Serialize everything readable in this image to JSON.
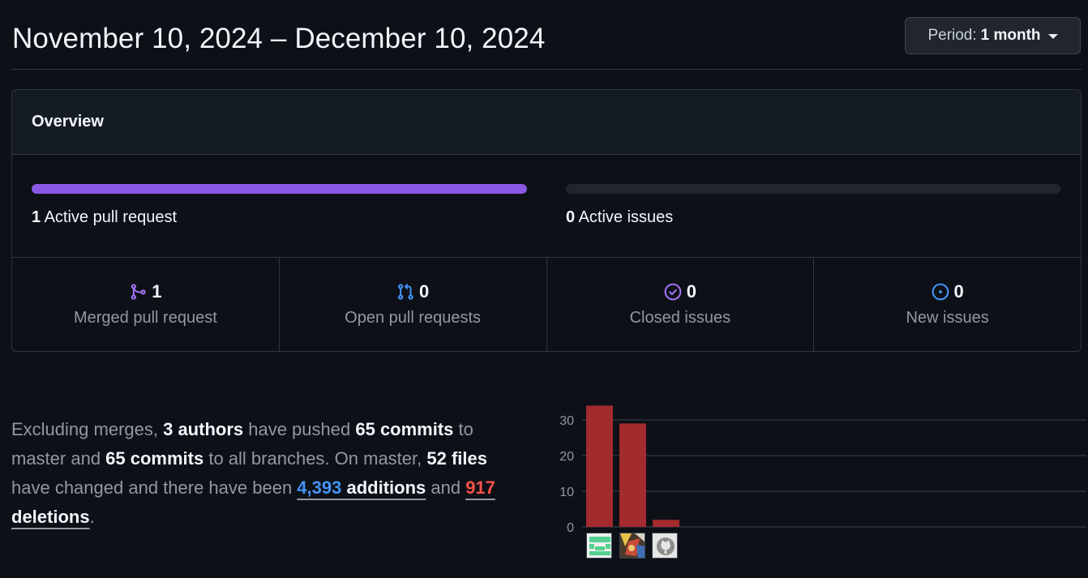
{
  "header": {
    "date_range": "November 10, 2024 – December 10, 2024",
    "period_label": "Period:",
    "period_value": "1 month"
  },
  "overview": {
    "title": "Overview",
    "active_prs": {
      "count": "1",
      "label": "Active pull request",
      "fill_fraction": 1.0,
      "color": "#8957e5"
    },
    "active_issues": {
      "count": "0",
      "label": "Active issues",
      "fill_fraction": 0.0
    },
    "stats": [
      {
        "count": "1",
        "label": "Merged pull request",
        "icon": "merged-pr-icon",
        "color": "#a371f7"
      },
      {
        "count": "0",
        "label": "Open pull requests",
        "icon": "open-pr-icon",
        "color": "#4493f8"
      },
      {
        "count": "0",
        "label": "Closed issues",
        "icon": "closed-issue-icon",
        "color": "#a371f7"
      },
      {
        "count": "0",
        "label": "New issues",
        "icon": "new-issue-icon",
        "color": "#4493f8"
      }
    ]
  },
  "summary": {
    "p1": "Excluding merges, ",
    "authors": "3 authors",
    "p2": " have pushed ",
    "commits_master": "65 commits",
    "p3": " to master and ",
    "commits_all": "65 commits",
    "p4": " to all branches. On master, ",
    "files": "52 files",
    "p5": " have changed and there have been ",
    "additions_num": "4,393",
    "additions_word": " additions",
    "p6": " and ",
    "deletions_num": "917",
    "deletions_word": " deletions",
    "p7": "."
  },
  "chart_data": {
    "type": "bar",
    "categories": [
      "author-1",
      "author-2",
      "author-3"
    ],
    "values": [
      34,
      29,
      2
    ],
    "yticks": [
      0,
      10,
      20,
      30
    ],
    "ylim": [
      0,
      30
    ],
    "bar_color": "#a32a2d",
    "grid": true
  }
}
